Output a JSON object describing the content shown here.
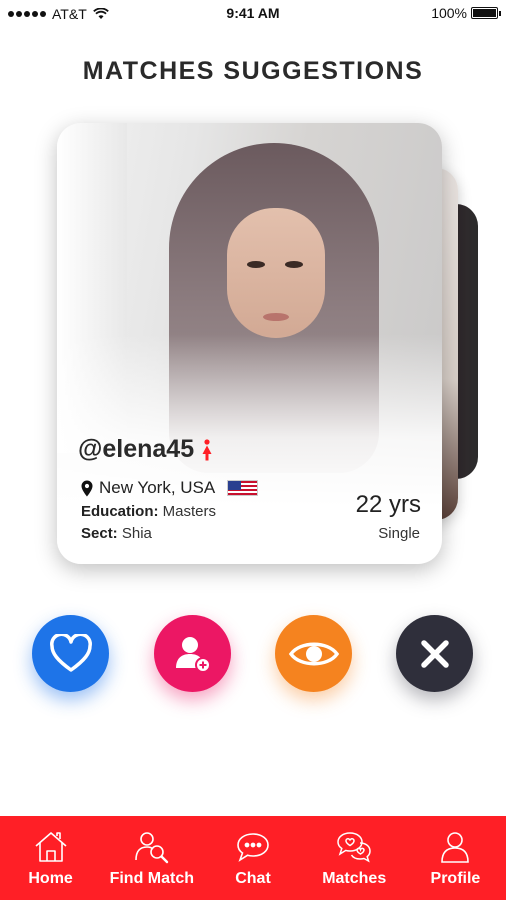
{
  "status_bar": {
    "carrier": "AT&T",
    "time": "9:41 AM",
    "battery": "100%"
  },
  "page": {
    "title": "MATCHES SUGGESTIONS"
  },
  "profile": {
    "username": "@elena45",
    "location": "New York, USA",
    "education_label": "Education:",
    "education_value": " Masters",
    "sect_label": "Sect:",
    "sect_value": " Shia",
    "age": "22 yrs",
    "status": "Single"
  },
  "actions": [
    {
      "name": "like",
      "icon": "heart-icon",
      "color": "#1e74e8"
    },
    {
      "name": "add",
      "icon": "add-user-icon",
      "color": "#ec1764"
    },
    {
      "name": "view",
      "icon": "eye-icon",
      "color": "#f5831f"
    },
    {
      "name": "skip",
      "icon": "close-icon",
      "color": "#2f2f3b"
    }
  ],
  "nav": {
    "background": "#ff1f26",
    "items": [
      {
        "label": "Home",
        "icon": "home-icon"
      },
      {
        "label": "Find Match",
        "icon": "find-match-icon"
      },
      {
        "label": "Chat",
        "icon": "chat-icon"
      },
      {
        "label": "Matches",
        "icon": "matches-icon"
      },
      {
        "label": "Profile",
        "icon": "profile-icon"
      }
    ]
  }
}
